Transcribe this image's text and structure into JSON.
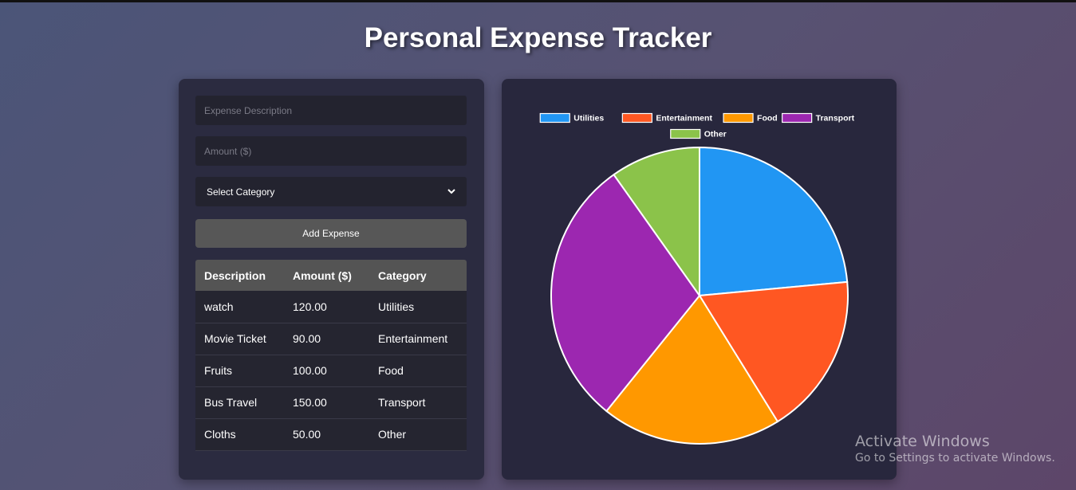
{
  "page": {
    "title": "Personal Expense Tracker"
  },
  "form": {
    "description_placeholder": "Expense Description",
    "description_value": "",
    "amount_placeholder": "Amount ($)",
    "amount_value": "",
    "category_selected": "Select Category",
    "category_icon": "chevron-down-icon",
    "add_button_label": "Add Expense"
  },
  "table": {
    "headers": [
      "Description",
      "Amount ($)",
      "Category"
    ],
    "rows": [
      [
        "watch",
        "120.00",
        "Utilities"
      ],
      [
        "Movie Ticket",
        "90.00",
        "Entertainment"
      ],
      [
        "Fruits",
        "100.00",
        "Food"
      ],
      [
        "Bus Travel",
        "150.00",
        "Transport"
      ],
      [
        "Cloths",
        "50.00",
        "Other"
      ]
    ]
  },
  "chart_data": {
    "type": "pie",
    "categories": [
      "Utilities",
      "Entertainment",
      "Food",
      "Transport",
      "Other"
    ],
    "values": [
      120,
      90,
      100,
      150,
      50
    ],
    "colors": [
      "#2196F3",
      "#FF5722",
      "#FF9800",
      "#9C27B0",
      "#8BC34A"
    ],
    "legend": "top",
    "title": ""
  },
  "watermark": {
    "title": "Activate Windows",
    "subtitle": "Go to Settings to activate Windows."
  }
}
